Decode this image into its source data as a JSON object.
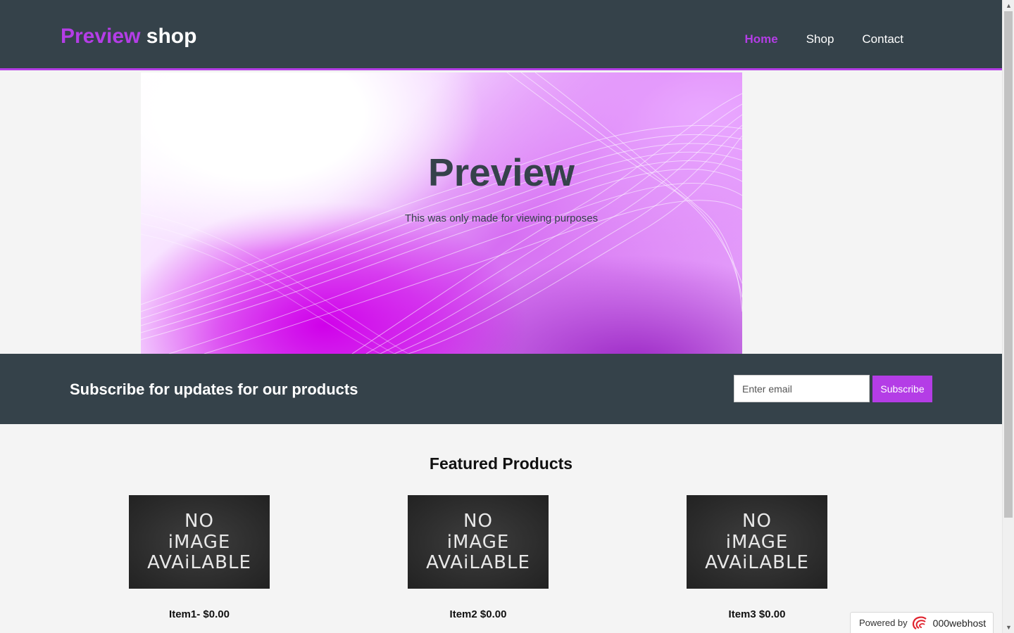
{
  "header": {
    "logo_accent": "Preview",
    "logo_rest": " shop",
    "nav": [
      {
        "label": "Home",
        "active": true
      },
      {
        "label": "Shop",
        "active": false
      },
      {
        "label": "Contact",
        "active": false
      }
    ]
  },
  "showcase": {
    "title": "Preview",
    "subtitle": "This was only made for viewing purposes"
  },
  "newsletter": {
    "heading": "Subscribe for updates for our products",
    "email_placeholder": "Enter email",
    "button_label": "Subscribe"
  },
  "products": {
    "heading": "Featured Products",
    "image_text": [
      "NO",
      "iMAGE",
      "AVAiLABLE"
    ],
    "items": [
      {
        "name": "Item1- $0.00"
      },
      {
        "name": "Item2 $0.00"
      },
      {
        "name": "Item3 $0.00"
      }
    ]
  },
  "badge": {
    "prefix": "Powered by",
    "brand": "000webhost"
  },
  "colors": {
    "accent": "#b43de6",
    "dark": "#35424a",
    "background": "#f4f4f4"
  }
}
